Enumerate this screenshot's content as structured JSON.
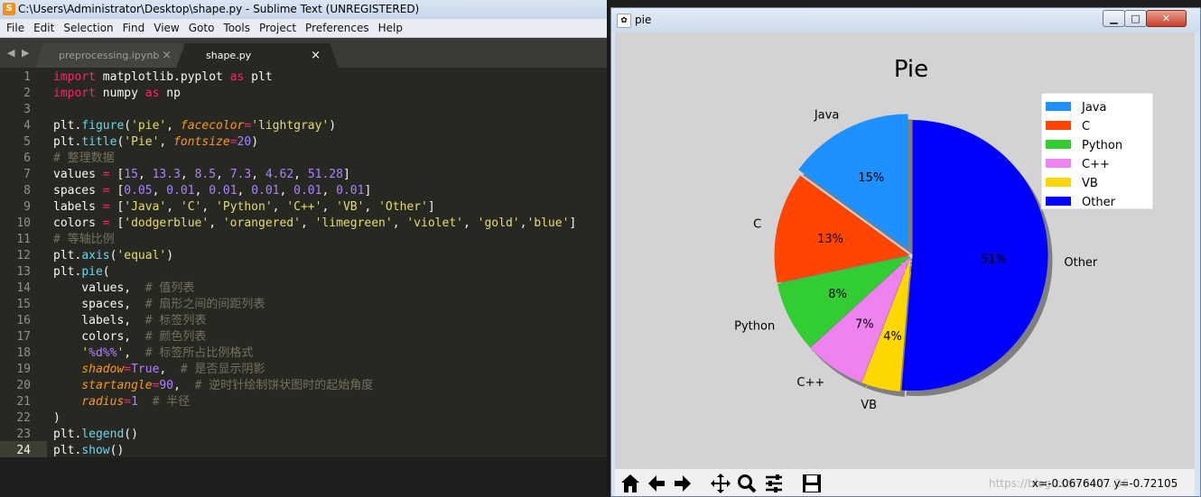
{
  "sublime": {
    "window_title": "C:\\Users\\Administrator\\Desktop\\shape.py - Sublime Text (UNREGISTERED)",
    "menu": [
      "File",
      "Edit",
      "Selection",
      "Find",
      "View",
      "Goto",
      "Tools",
      "Project",
      "Preferences",
      "Help"
    ],
    "tabs": [
      {
        "label": "preprocessing.ipynb",
        "close": "×"
      },
      {
        "label": "shape.py",
        "close": "×"
      }
    ],
    "nav_arrows": "◀ ▶",
    "line_numbers": [
      "1",
      "2",
      "3",
      "4",
      "5",
      "6",
      "7",
      "8",
      "9",
      "10",
      "11",
      "12",
      "13",
      "14",
      "15",
      "16",
      "17",
      "18",
      "19",
      "20",
      "21",
      "22",
      "23",
      "24"
    ],
    "code": {
      "l1": {
        "kw1": "import",
        "mod": " matplotlib.pyplot ",
        "kw2": "as",
        "alias": " plt"
      },
      "l2": {
        "kw1": "import",
        "mod": " numpy ",
        "kw2": "as",
        "alias": " np"
      },
      "l4": {
        "a": "plt.",
        "fn": "figure",
        "b": "(",
        "s1": "'pie'",
        "c": ", ",
        "param": "facecolor",
        "eq": "=",
        "s2": "'lightgray'",
        "d": ")"
      },
      "l5": {
        "a": "plt.",
        "fn": "title",
        "b": "(",
        "s1": "'Pie'",
        "c": ", ",
        "param": "fontsize",
        "eq": "=",
        "num": "20",
        "d": ")"
      },
      "l6": "# 整理数据",
      "l7": {
        "a": "values ",
        "eq": "=",
        "b": " [",
        "n1": "15",
        "c1": ", ",
        "n2": "13.3",
        "c2": ", ",
        "n3": "8.5",
        "c3": ", ",
        "n4": "7.3",
        "c4": ", ",
        "n5": "4.62",
        "c5": ", ",
        "n6": "51.28",
        "d": "]"
      },
      "l8": {
        "a": "spaces ",
        "eq": "=",
        "b": " [",
        "n1": "0.05",
        "c1": ", ",
        "n2": "0.01",
        "c2": ", ",
        "n3": "0.01",
        "c3": ", ",
        "n4": "0.01",
        "c4": ", ",
        "n5": "0.01",
        "c5": ", ",
        "n6": "0.01",
        "d": "]"
      },
      "l9": {
        "a": "labels ",
        "eq": "=",
        "b": " [",
        "s1": "'Java'",
        "c1": ", ",
        "s2": "'C'",
        "c2": ", ",
        "s3": "'Python'",
        "c3": ", ",
        "s4": "'C++'",
        "c4": ", ",
        "s5": "'VB'",
        "c5": ", ",
        "s6": "'Other'",
        "d": "]"
      },
      "l10": {
        "a": "colors ",
        "eq": "=",
        "b": " [",
        "s1": "'dodgerblue'",
        "c1": ", ",
        "s2": "'orangered'",
        "c2": ", ",
        "s3": "'limegreen'",
        "c3": ", ",
        "s4": "'violet'",
        "c4": ", ",
        "s5": "'gold'",
        "c5": ",",
        "s6": "'blue'",
        "d": "]"
      },
      "l11": "# 等轴比例",
      "l12": {
        "a": "plt.",
        "fn": "axis",
        "b": "(",
        "s1": "'equal'",
        "d": ")"
      },
      "l13": {
        "a": "plt.",
        "fn": "pie",
        "b": "("
      },
      "l14": {
        "a": "    values,  ",
        "cm": "# 值列表"
      },
      "l15": {
        "a": "    spaces,  ",
        "cm": "# 扇形之间的间距列表"
      },
      "l16": {
        "a": "    labels,  ",
        "cm": "# 标签列表"
      },
      "l17": {
        "a": "    colors,  ",
        "cm": "# 颜色列表"
      },
      "l18": {
        "ind": "    ",
        "s1": "'",
        "fmt": "%d%%",
        "s2": "'",
        "c": ",  ",
        "cm": "# 标签所占比例格式"
      },
      "l19": {
        "ind": "    ",
        "param": "shadow",
        "eq": "=",
        "val": "True",
        "c": ",  ",
        "cm": "# 是否显示阴影"
      },
      "l20": {
        "ind": "    ",
        "param": "startangle",
        "eq": "=",
        "num": "90",
        "c": ",  ",
        "cm": "# 逆时针绘制饼状图时的起始角度"
      },
      "l21": {
        "ind": "    ",
        "param": "radius",
        "eq": "=",
        "num": "1",
        "c": "  ",
        "cm": "# 半径"
      },
      "l22": ")",
      "l23": {
        "a": "plt.",
        "fn": "legend",
        "b": "()"
      },
      "l24": {
        "a": "plt.",
        "fn": "show",
        "b": "()"
      }
    }
  },
  "figure": {
    "window_title": "pie",
    "window_buttons": {
      "min": "▁",
      "max": "□",
      "close": "✕"
    },
    "toolbar": {
      "buttons": [
        "home-icon",
        "back-icon",
        "forward-icon",
        "pan-icon",
        "zoom-icon",
        "subplots-icon",
        "save-icon"
      ],
      "coords": "x=-0.0676407   y=-0.72105",
      "watermark": "https://blog.csdn.net/...36"
    }
  },
  "chart_data": {
    "type": "pie",
    "title": "Pie",
    "start_angle": 90,
    "shadow": true,
    "legend_position": "top-right",
    "facecolor": "#d3d3d3",
    "slices": [
      {
        "label": "Java",
        "value": 15,
        "pct": "15%",
        "color": "#1e90ff",
        "explode": 0.05
      },
      {
        "label": "C",
        "value": 13.3,
        "pct": "13%",
        "color": "#ff4500",
        "explode": 0.01
      },
      {
        "label": "Python",
        "value": 8.5,
        "pct": "8%",
        "color": "#32cd32",
        "explode": 0.01
      },
      {
        "label": "C++",
        "value": 7.3,
        "pct": "7%",
        "color": "#ee82ee",
        "explode": 0.01
      },
      {
        "label": "VB",
        "value": 4.62,
        "pct": "4%",
        "color": "#ffd700",
        "explode": 0.01
      },
      {
        "label": "Other",
        "value": 51.28,
        "pct": "51%",
        "color": "#0000ff",
        "explode": 0.01
      }
    ]
  }
}
